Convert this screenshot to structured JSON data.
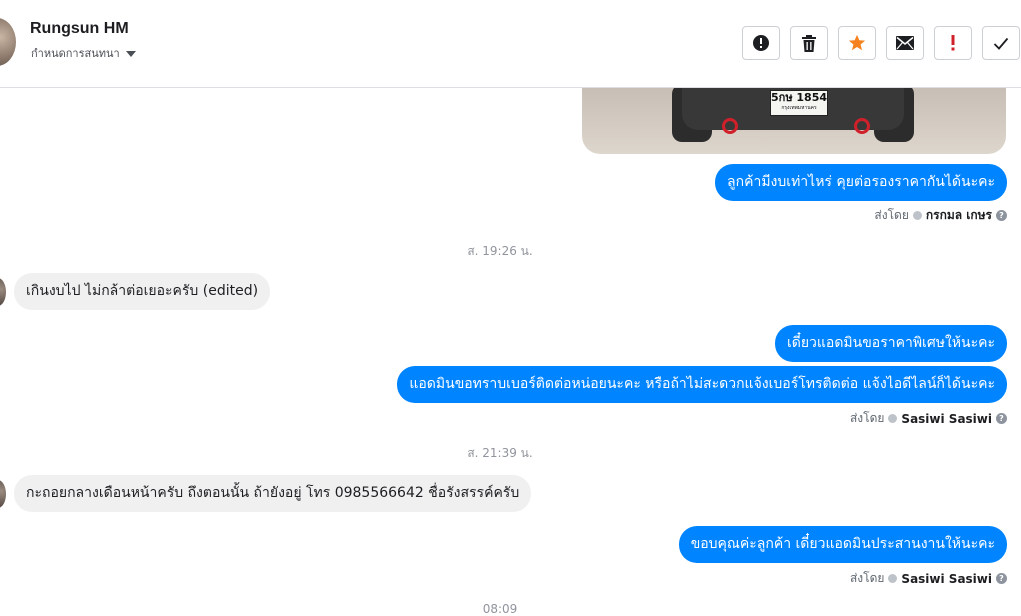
{
  "header": {
    "contact_name": "Rungsun HM",
    "assign_label": "กำหนดการสนทนา",
    "actions": [
      {
        "name": "spam",
        "icon": "alert-circle-icon"
      },
      {
        "name": "delete",
        "icon": "trash-icon"
      },
      {
        "name": "star",
        "icon": "star-icon"
      },
      {
        "name": "mark-unread",
        "icon": "envelope-icon"
      },
      {
        "name": "follow-up",
        "icon": "exclamation-icon"
      },
      {
        "name": "done",
        "icon": "check-icon"
      }
    ]
  },
  "attachment": {
    "plate_text": "5กษ 1854",
    "plate_sub": "กรุงเทพมหานคร"
  },
  "messages": [
    {
      "dir": "out",
      "text": "ลูกค้ามีงบเท่าไหร่ คุยต่อรองราคากันได้นะคะ"
    },
    {
      "dir": "in",
      "text": "เกินงบไป ไม่กล้าต่อเยอะครับ (edited)"
    },
    {
      "dir": "out",
      "text": "เดี๋ยวแอดมินขอราคาพิเศษให้นะคะ"
    },
    {
      "dir": "out",
      "text": "แอดมินขอทราบเบอร์ติดต่อหน่อยนะคะ หรือถ้าไม่สะดวกแจ้งเบอร์โทรติดต่อ แจ้งไอดีไลน์ก็ได้นะคะ"
    },
    {
      "dir": "in",
      "text": "กะถอยกลางเดือนหน้าครับ  ถึงตอนนั้น ถ้ายังอยู่  โทร 0985566642 ชื่อรังสรรค์ครับ"
    },
    {
      "dir": "out",
      "text": "ขอบคุณค่ะลูกค้า เดี๋ยวแอดมินประสานงานให้นะคะ"
    }
  ],
  "sent_by_label": "ส่งโดย",
  "senders": [
    "กรกมล เกษร",
    "Sasiwi Sasiwi",
    "Sasiwi Sasiwi"
  ],
  "timestamps": [
    "ส. 19:26 น.",
    "ส. 21:39 น.",
    "08:09"
  ],
  "colors": {
    "outgoing": "#0084ff",
    "incoming": "#f1f0f0",
    "star": "#f5821f",
    "alert": "#d0202a"
  }
}
